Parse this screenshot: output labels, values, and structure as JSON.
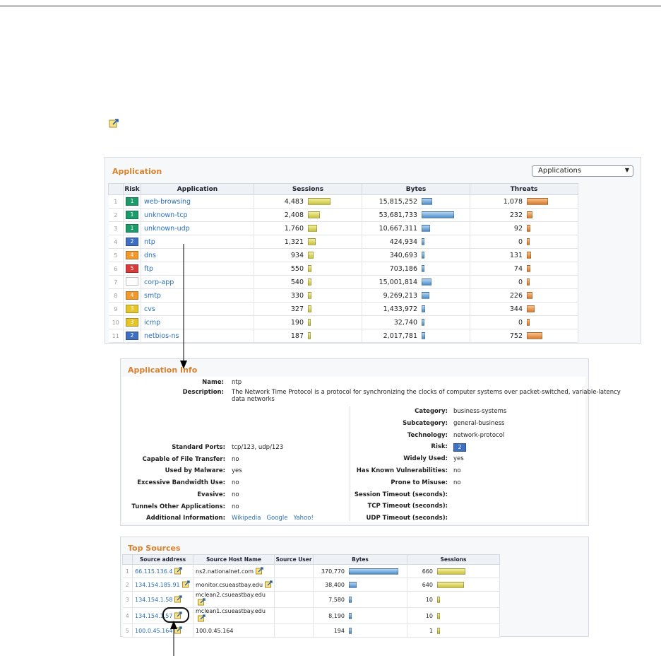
{
  "app": {
    "title": "Application",
    "dropdown": "Applications",
    "columns": {
      "risk": "Risk",
      "application": "Application",
      "sessions": "Sessions",
      "bytes": "Bytes",
      "threats": "Threats"
    },
    "rows": [
      {
        "n": "1",
        "risk": "1",
        "name": "web-browsing",
        "sessions": "4,483",
        "bytes": "15,815,252",
        "threats": "1,078",
        "s": 30,
        "b": 13,
        "t": 28
      },
      {
        "n": "2",
        "risk": "1",
        "name": "unknown-tcp",
        "sessions": "2,408",
        "bytes": "53,681,733",
        "threats": "232",
        "s": 15,
        "b": 44,
        "t": 6
      },
      {
        "n": "3",
        "risk": "1",
        "name": "unknown-udp",
        "sessions": "1,760",
        "bytes": "10,667,311",
        "threats": "92",
        "s": 11,
        "b": 10,
        "t": 3
      },
      {
        "n": "4",
        "risk": "2",
        "name": "ntp",
        "sessions": "1,321",
        "bytes": "424,934",
        "threats": "0",
        "s": 9,
        "b": 2,
        "t": 2
      },
      {
        "n": "5",
        "risk": "4",
        "name": "dns",
        "sessions": "934",
        "bytes": "340,693",
        "threats": "131",
        "s": 6,
        "b": 2,
        "t": 4
      },
      {
        "n": "6",
        "risk": "5",
        "name": "ftp",
        "sessions": "550",
        "bytes": "703,186",
        "threats": "74",
        "s": 3,
        "b": 2,
        "t": 3
      },
      {
        "n": "7",
        "risk": "",
        "name": "corp-app",
        "sessions": "540",
        "bytes": "15,001,814",
        "threats": "0",
        "s": 3,
        "b": 12,
        "t": 2
      },
      {
        "n": "8",
        "risk": "4",
        "name": "smtp",
        "sessions": "330",
        "bytes": "9,269,213",
        "threats": "226",
        "s": 3,
        "b": 9,
        "t": 6
      },
      {
        "n": "9",
        "risk": "3",
        "name": "cvs",
        "sessions": "327",
        "bytes": "1,433,972",
        "threats": "344",
        "s": 3,
        "b": 3,
        "t": 9
      },
      {
        "n": "10",
        "risk": "3",
        "name": "icmp",
        "sessions": "190",
        "bytes": "32,740",
        "threats": "0",
        "s": 2,
        "b": 2,
        "t": 2
      },
      {
        "n": "11",
        "risk": "2",
        "name": "netbios-ns",
        "sessions": "187",
        "bytes": "2,017,781",
        "threats": "752",
        "s": 2,
        "b": 3,
        "t": 20
      }
    ]
  },
  "info": {
    "title": "Application Info",
    "name_label": "Name:",
    "name": "ntp",
    "desc_label": "Description:",
    "desc1": "The Network Time Protocol is a protocol for synchronizing the clocks of computer systems over packet-switched, variable-latency",
    "desc2": "data networks",
    "left": [
      {
        "label": "Standard Ports:",
        "value": "tcp/123, udp/123"
      },
      {
        "label": "Capable of File Transfer:",
        "value": "no"
      },
      {
        "label": "Used by Malware:",
        "value": "yes"
      },
      {
        "label": "Excessive Bandwidth Use:",
        "value": "no"
      },
      {
        "label": "Evasive:",
        "value": "no"
      },
      {
        "label": "Tunnels Other Applications:",
        "value": "no"
      },
      {
        "label": "Additional Information:",
        "value": ""
      }
    ],
    "links": [
      "Wikipedia",
      "Google",
      "Yahoo!"
    ],
    "right": [
      {
        "label": "Category:",
        "value": "business-systems"
      },
      {
        "label": "Subcategory:",
        "value": "general-business"
      },
      {
        "label": "Technology:",
        "value": "network-protocol"
      },
      {
        "label": "Risk:",
        "value": "2"
      },
      {
        "label": "Widely Used:",
        "value": "yes"
      },
      {
        "label": "Has Known Vulnerabilities:",
        "value": "no"
      },
      {
        "label": "Prone to Misuse:",
        "value": "no"
      },
      {
        "label": "Session Timeout (seconds):",
        "value": ""
      },
      {
        "label": "TCP Timeout (seconds):",
        "value": ""
      },
      {
        "label": "UDP Timeout (seconds):",
        "value": ""
      }
    ]
  },
  "sources": {
    "title": "Top Sources",
    "columns": {
      "addr": "Source address",
      "host": "Source Host Name",
      "user": "Source User",
      "bytes": "Bytes",
      "sessions": "Sessions"
    },
    "rows": [
      {
        "n": "1",
        "addr": "66.115.136.4",
        "host": "ns2.nationalnet.com",
        "user": "",
        "bytes": "370,770",
        "sessions": "660",
        "b": 68,
        "s": 38
      },
      {
        "n": "2",
        "addr": "134.154.185.91",
        "host": "monitor.csueastbay.edu",
        "user": "",
        "bytes": "38,400",
        "sessions": "640",
        "b": 9,
        "s": 36
      },
      {
        "n": "3",
        "addr": "134.154.1.58",
        "host": "mclean2.csueastbay.edu",
        "user": "",
        "bytes": "7,580",
        "sessions": "10",
        "b": 2,
        "s": 2
      },
      {
        "n": "4",
        "addr": "134.154.1.57",
        "host": "mclean1.csueastbay.edu",
        "user": "",
        "bytes": "8,190",
        "sessions": "10",
        "b": 2,
        "s": 2
      },
      {
        "n": "5",
        "addr": "100.0.45.164",
        "host": "100.0.45.164",
        "user": "",
        "bytes": "194",
        "sessions": "1",
        "b": 2,
        "s": 2
      }
    ]
  },
  "colors": {
    "accent": "#d9822b",
    "link": "#2a6fb8",
    "risk1": "#1c9a6a",
    "risk2": "#3f6fc0",
    "risk3": "#e6c52a",
    "risk4": "#f09a2e",
    "risk5": "#d83a3a"
  }
}
